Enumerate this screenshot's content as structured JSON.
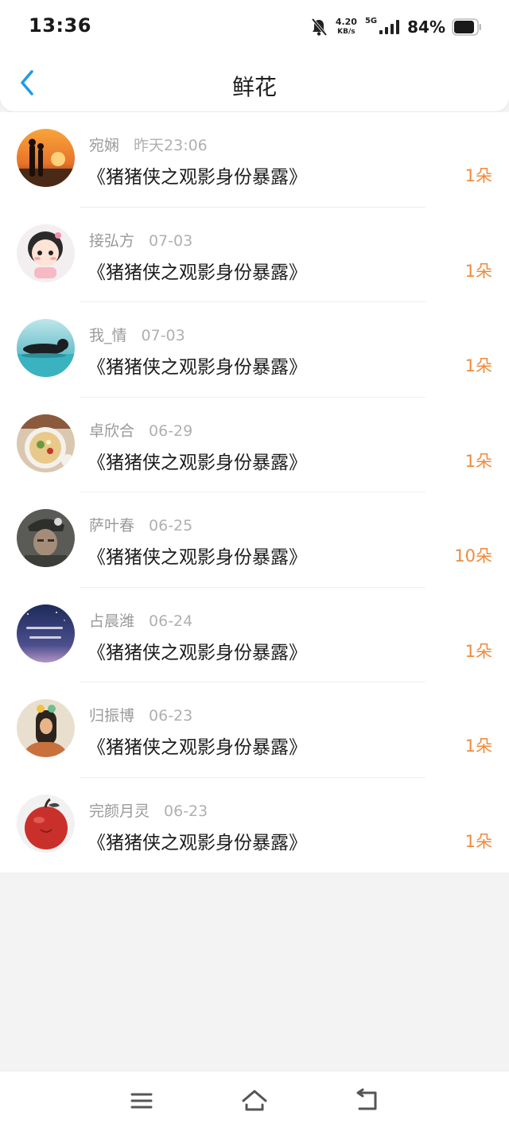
{
  "status_bar": {
    "time": "13:36",
    "net_speed_value": "4.20",
    "net_speed_unit": "KB/s",
    "network_type": "5G",
    "battery_percent": "84%",
    "icons": [
      "bell-muted-icon",
      "signal-icon",
      "battery-icon"
    ]
  },
  "header": {
    "back_icon": "chevron-left-icon",
    "title": "鲜花"
  },
  "colors": {
    "accent_blue": "#1f9be6",
    "count_orange": "#f08a3c",
    "meta_gray": "#9a9a9a",
    "page_background": "#f4f3f4"
  },
  "items": [
    {
      "name": "宛娴",
      "time": "昨天23:06",
      "movie": "《猪猪侠之观影身份暴露》",
      "count": "1朵",
      "avatar": "sunset-couple"
    },
    {
      "name": "接弘方",
      "time": "07-03",
      "movie": "《猪猪侠之观影身份暴露》",
      "count": "1朵",
      "avatar": "cartoon-girl"
    },
    {
      "name": "我_情",
      "time": "07-03",
      "movie": "《猪猪侠之观影身份暴露》",
      "count": "1朵",
      "avatar": "reclining-statue"
    },
    {
      "name": "卓欣合",
      "time": "06-29",
      "movie": "《猪猪侠之观影身份暴露》",
      "count": "1朵",
      "avatar": "noodle-bowl"
    },
    {
      "name": "萨叶春",
      "time": "06-25",
      "movie": "《猪猪侠之观影身份暴露》",
      "count": "10朵",
      "avatar": "soldier"
    },
    {
      "name": "占晨潍",
      "time": "06-24",
      "movie": "《猪猪侠之观影身份暴露》",
      "count": "1朵",
      "avatar": "night-sky-text"
    },
    {
      "name": "归振博",
      "time": "06-23",
      "movie": "《猪猪侠之观影身份暴露》",
      "count": "1朵",
      "avatar": "cartoon-character"
    },
    {
      "name": "完颜月灵",
      "time": "06-23",
      "movie": "《猪猪侠之观影身份暴露》",
      "count": "1朵",
      "avatar": "red-apple"
    }
  ],
  "nav_bar": {
    "icons": [
      "menu-icon",
      "home-icon",
      "back-icon"
    ]
  }
}
